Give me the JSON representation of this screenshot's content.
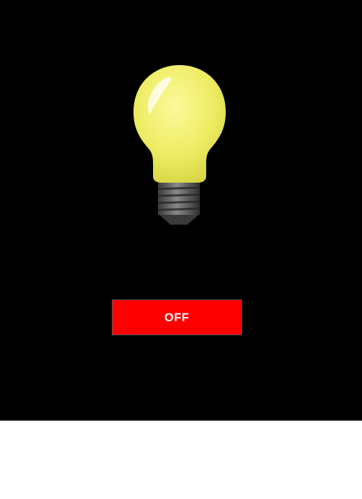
{
  "app": {
    "background_color": "#000000",
    "footer_color": "#ffffff"
  },
  "bulb": {
    "icon": "light-bulb-icon",
    "glass_color": "#f2f06a",
    "base_color": "#5c5c5c"
  },
  "toggle": {
    "label": "OFF",
    "color": "#ff0000",
    "text_color": "#ffffff"
  }
}
